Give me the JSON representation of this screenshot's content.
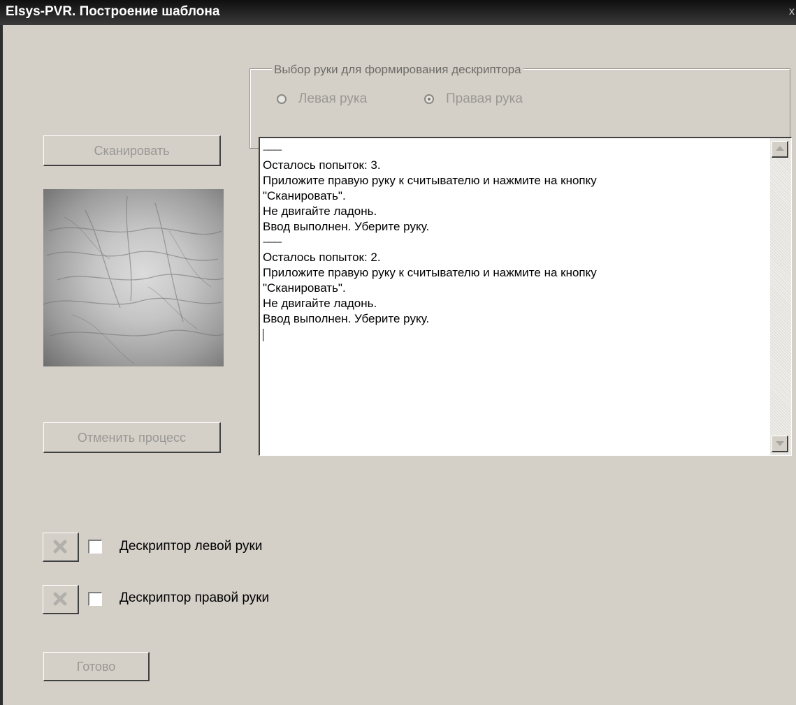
{
  "window": {
    "title": "Elsys-PVR. Построение шаблона",
    "close_glyph": "x"
  },
  "hand_selection": {
    "legend": "Выбор руки для формирования дескриптора",
    "options": [
      {
        "label": "Левая рука",
        "selected": false
      },
      {
        "label": "Правая рука",
        "selected": true
      }
    ]
  },
  "buttons": {
    "scan": "Сканировать",
    "cancel_process": "Отменить процесс",
    "done": "Готово"
  },
  "log": {
    "lines": [
      "----------",
      "Осталось попыток: 3.",
      "Приложите правую руку к считывателю и нажмите на кнопку",
      "\"Сканировать\".",
      "Не двигайте ладонь.",
      "Ввод выполнен. Уберите руку.",
      "----------",
      "Осталось попыток: 2.",
      "Приложите правую руку к считывателю и нажмите на кнопку",
      "\"Сканировать\".",
      "Не двигайте ладонь.",
      "Ввод выполнен. Уберите руку."
    ]
  },
  "descriptors": [
    {
      "label": "Дескриптор левой руки",
      "checked": false
    },
    {
      "label": "Дескриптор правой руки",
      "checked": false
    }
  ],
  "icons": {
    "delete": "delete-x-icon",
    "scroll_up": "arrow-up-icon",
    "scroll_down": "arrow-down-icon"
  },
  "colors": {
    "dialog_bg": "#d4d0c8",
    "titlebar_bg": "#1c1c1c",
    "disabled_text": "#9a9894"
  }
}
